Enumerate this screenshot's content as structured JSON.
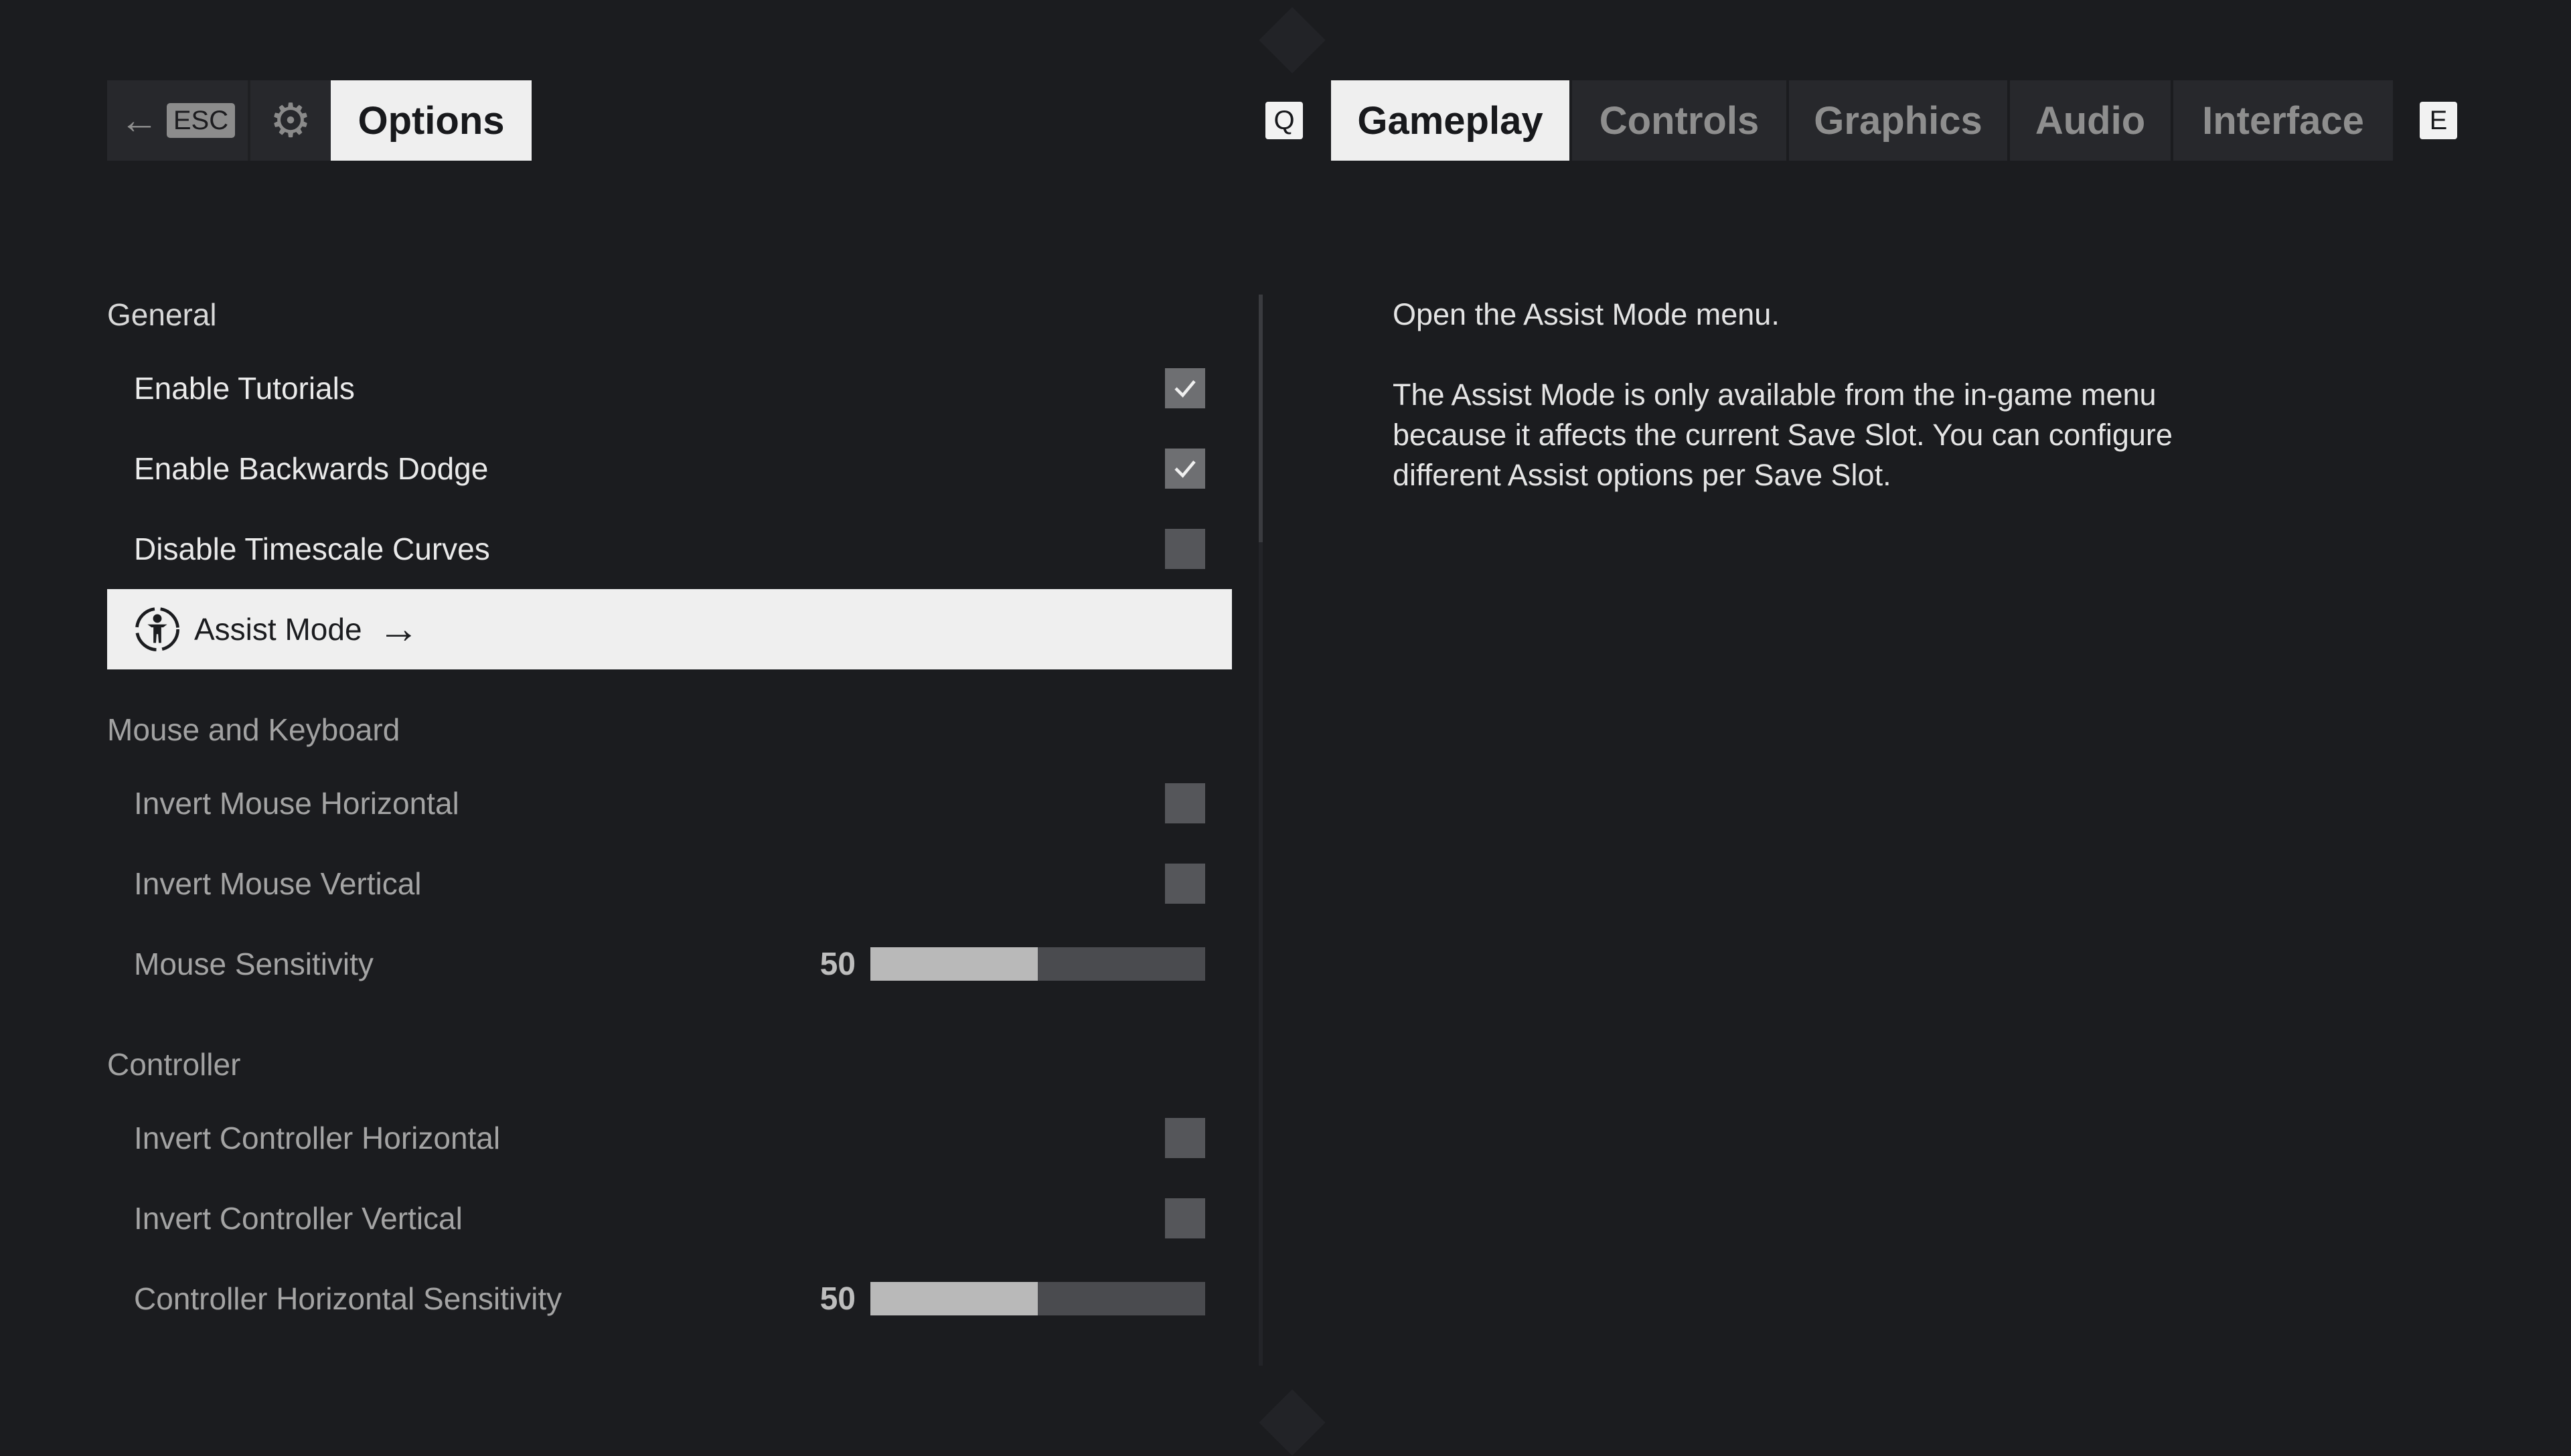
{
  "header": {
    "back_key": "ESC",
    "title": "Options",
    "prev_tab_key": "Q",
    "next_tab_key": "E",
    "tabs": [
      {
        "label": "Gameplay",
        "active": true
      },
      {
        "label": "Controls",
        "active": false
      },
      {
        "label": "Graphics",
        "active": false
      },
      {
        "label": "Audio",
        "active": false
      },
      {
        "label": "Interface",
        "active": false
      }
    ]
  },
  "sections": {
    "general": {
      "title": "General",
      "enable_tutorials": {
        "label": "Enable Tutorials",
        "checked": true
      },
      "enable_backwards_dodge": {
        "label": "Enable Backwards Dodge",
        "checked": true
      },
      "disable_timescale_curves": {
        "label": "Disable Timescale Curves",
        "checked": false
      },
      "assist_mode": {
        "label": "Assist Mode"
      }
    },
    "mouse_keyboard": {
      "title": "Mouse and Keyboard",
      "invert_mouse_horizontal": {
        "label": "Invert Mouse Horizontal",
        "checked": false
      },
      "invert_mouse_vertical": {
        "label": "Invert Mouse Vertical",
        "checked": false
      },
      "mouse_sensitivity": {
        "label": "Mouse Sensitivity",
        "value": "50",
        "fraction": 0.5
      }
    },
    "controller": {
      "title": "Controller",
      "invert_controller_horizontal": {
        "label": "Invert Controller Horizontal",
        "checked": false
      },
      "invert_controller_vertical": {
        "label": "Invert Controller Vertical",
        "checked": false
      },
      "controller_horizontal_sensitivity": {
        "label": "Controller Horizontal Sensitivity",
        "value": "50",
        "fraction": 0.5
      }
    }
  },
  "description": {
    "line1": "Open the Assist Mode menu.",
    "line2": "The Assist Mode is only available from the in-game menu because it affects the current Save Slot. You can configure different Assist options per Save Slot."
  },
  "colors": {
    "background": "#1b1c1f",
    "highlight": "#efefef",
    "checkbox": "#55565a",
    "slider_fill": "#b9b9b9"
  }
}
